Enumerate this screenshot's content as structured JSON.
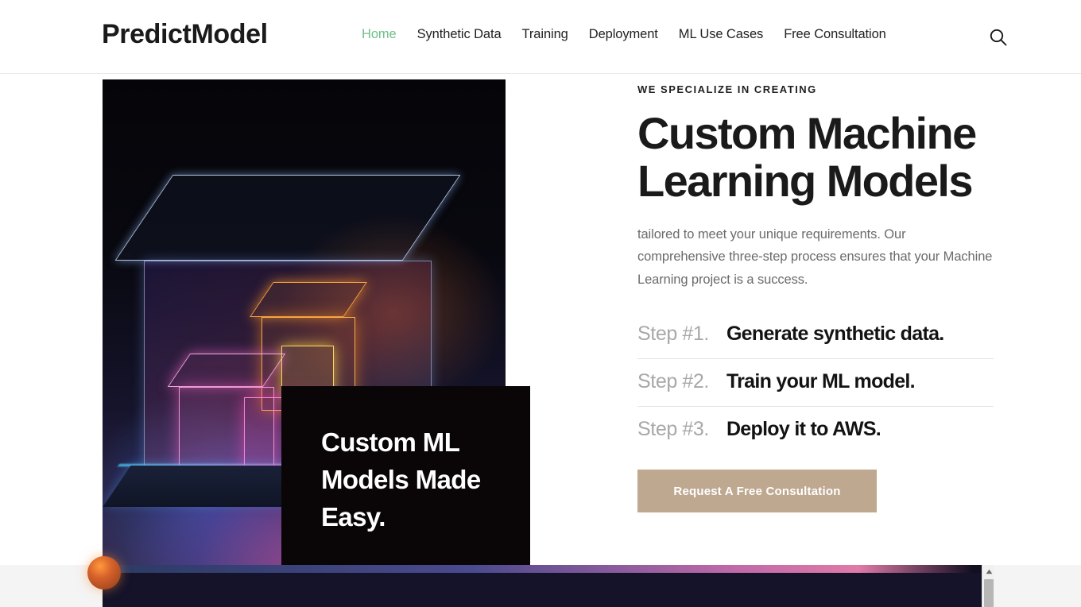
{
  "header": {
    "brand": "PredictModel",
    "nav": [
      {
        "label": "Home",
        "active": true
      },
      {
        "label": "Synthetic Data",
        "active": false
      },
      {
        "label": "Training",
        "active": false
      },
      {
        "label": "Deployment",
        "active": false
      },
      {
        "label": "ML Use Cases",
        "active": false
      },
      {
        "label": "Free Consultation",
        "active": false
      }
    ],
    "search_icon": "search-icon",
    "active_color": "#6fbf8a"
  },
  "hero": {
    "image_alt": "neon wireframe glass cubes artwork",
    "overlay_card": {
      "title": "Custom ML Models Made Easy.",
      "background": "#0a0607",
      "text_color": "#ffffff"
    }
  },
  "copy": {
    "eyebrow": "WE SPECIALIZE IN CREATING",
    "title": "Custom Machine Learning Models",
    "description": "tailored to meet your unique requirements. Our comprehensive three-step process ensures that your Machine Learning project is a success.",
    "steps": [
      {
        "number": "Step #1.",
        "text": "Generate synthetic data."
      },
      {
        "number": "Step #2.",
        "text": "Train your ML model."
      },
      {
        "number": "Step #3.",
        "text": "Deploy it to AWS."
      }
    ],
    "cta": {
      "label": "Request A Free Consultation",
      "background": "#bfa890",
      "text_color": "#ffffff"
    }
  },
  "bottom_bar": {
    "orb_icon": "orange-orb-icon",
    "scroll_up_icon": "scroll-up-arrow-icon",
    "panel_color": "#14132a"
  }
}
